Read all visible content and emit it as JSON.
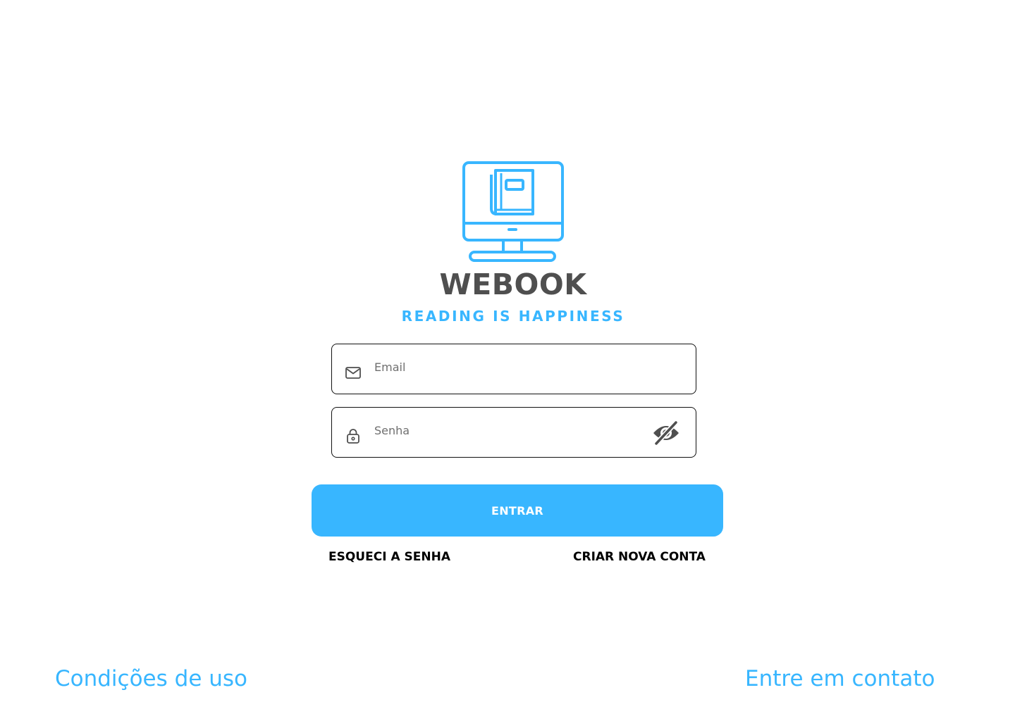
{
  "brand": {
    "name": "WEBOOK",
    "tagline": "READING IS HAPPINESS",
    "logo_icon": "monitor-book-icon",
    "primary_color": "#38b6ff",
    "title_color": "#4f4f4f"
  },
  "login_form": {
    "email": {
      "placeholder": "Email",
      "value": "",
      "icon": "mail-icon"
    },
    "password": {
      "placeholder": "Senha",
      "value": "",
      "icon": "lock-icon",
      "toggle_icon": "eye-off-icon"
    },
    "submit_label": "ENTRAR",
    "forgot_password_label": "ESQUECI A SENHA",
    "create_account_label": "CRIAR NOVA CONTA"
  },
  "footer": {
    "terms_label": "Condições de uso",
    "contact_label": "Entre em contato"
  }
}
